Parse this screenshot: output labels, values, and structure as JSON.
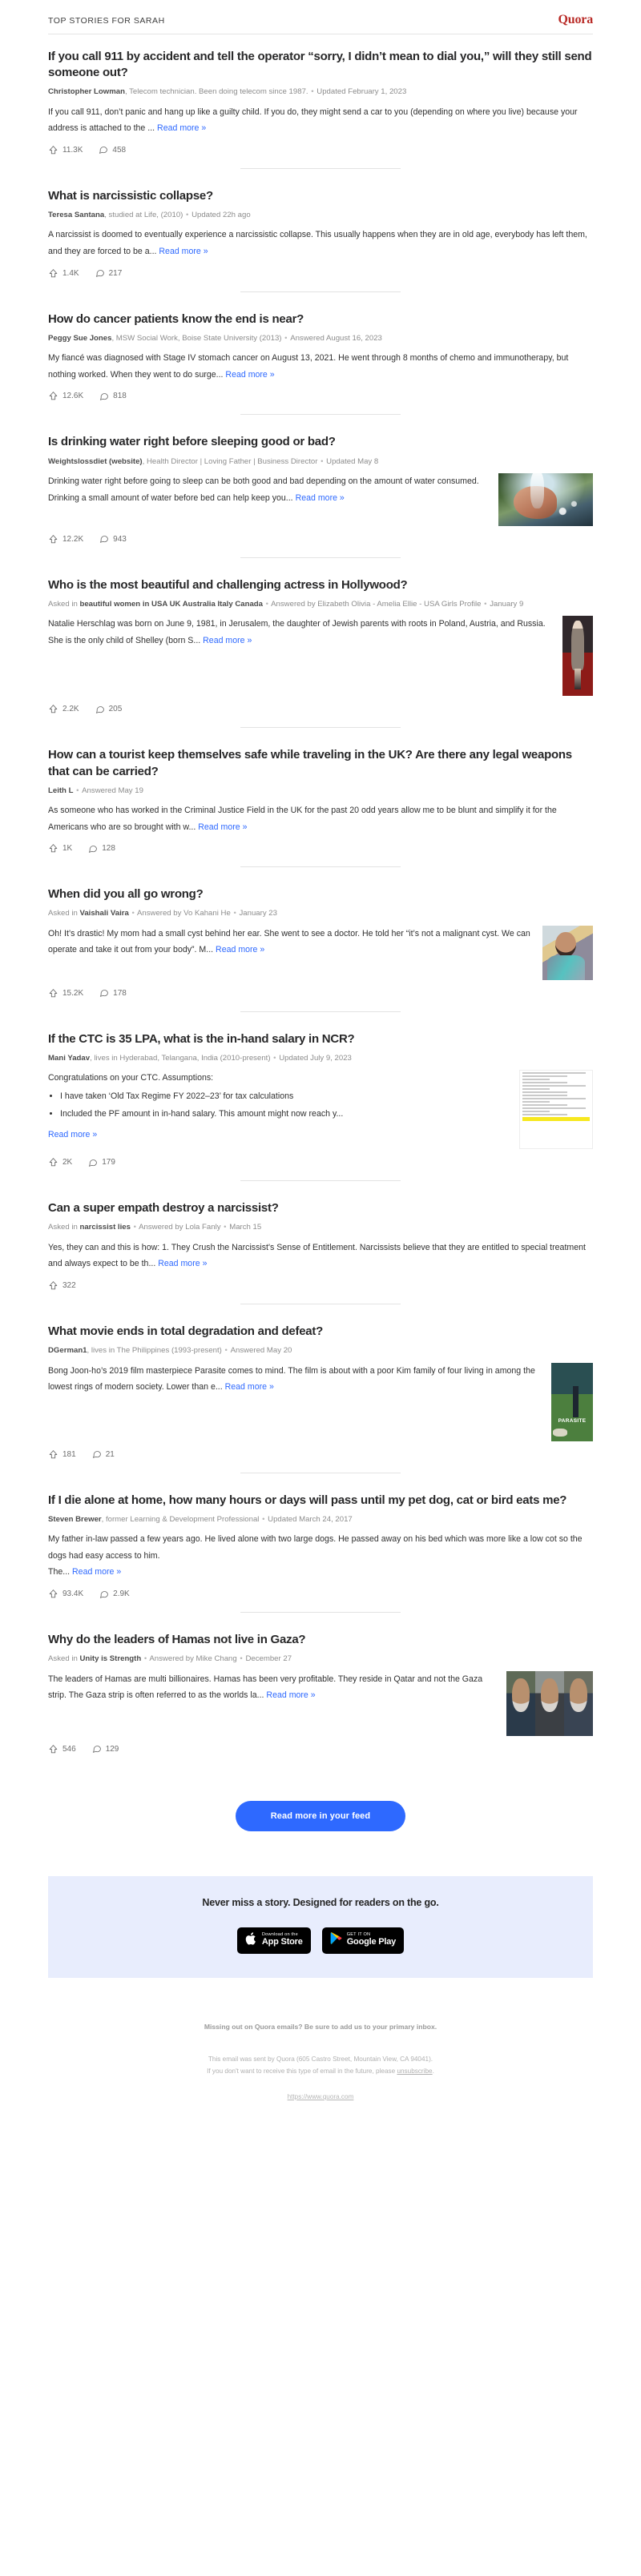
{
  "header": {
    "title": "TOP STORIES FOR SARAH",
    "brand": "Quora"
  },
  "labels": {
    "read_more": "Read more »",
    "asked_in": "Asked in ",
    "answered_by": " Answered by ",
    "dot": "•"
  },
  "stories": [
    {
      "title": "If you call 911 by accident and tell the operator “sorry, I didn’t mean to dial you,” will they still send someone out?",
      "author": "Christopher Lowman",
      "credential": ", Telecom technician. Been doing telecom since 1987.",
      "date": "Updated February 1, 2023",
      "excerpt": "If you call 911, don’t panic and hang up like a guilty child. If you do, they might send a car to you (depending on where you live) because your address is attached to the ...",
      "upvotes": "11.3K",
      "comments": "458",
      "thumb": "none"
    },
    {
      "title": "What is narcissistic collapse?",
      "author": "Teresa Santana",
      "credential": ", studied at Life, (2010)",
      "date": "Updated 22h ago",
      "excerpt": "A narcissist is doomed to eventually experience a narcissistic collapse. This usually happens when they are in old age, everybody has left them, and they are forced to be a...",
      "upvotes": "1.4K",
      "comments": "217",
      "thumb": "none"
    },
    {
      "title": "How do cancer patients know the end is near?",
      "author": "Peggy Sue Jones",
      "credential": ", MSW Social Work, Boise State University (2013)",
      "date": "Answered August 16, 2023",
      "excerpt": "My fiancé was diagnosed with Stage IV stomach cancer on August 13, 2021. He went through 8 months of chemo and immunotherapy, but nothing worked. When they went to do surge...",
      "upvotes": "12.6K",
      "comments": "818",
      "thumb": "none"
    },
    {
      "title": "Is drinking water right before sleeping good or bad?",
      "author": "Weightslossdiet (website)",
      "credential": ", Health Director | Loving Father | Business Director",
      "date": "Updated May 8",
      "excerpt": "Drinking water right before going to sleep can be both good and bad depending on the amount of water consumed. Drinking a small amount of water before bed can help keep you...",
      "upvotes": "12.2K",
      "comments": "943",
      "thumb": "water-hands-photo"
    },
    {
      "title": "Who is the most beautiful and challenging actress in Hollywood?",
      "topic": "beautiful women in USA UK Australia Italy Canada",
      "answerer": "Elizabeth Olivia - Amelia Ellie - USA Girls Profile",
      "date": "January 9",
      "excerpt": "Natalie Herschlag was born on June 9, 1981, in Jerusalem, the daughter of Jewish parents with roots in Poland, Austria, and Russia. She is the only child of Shelley (born S...",
      "upvotes": "2.2K",
      "comments": "205",
      "thumb": "actress-red-carpet-photo"
    },
    {
      "title": "How can a tourist keep themselves safe while traveling in the UK? Are there any legal weapons that can be carried?",
      "author": "Leith L",
      "credential": "",
      "date": "Answered May 19",
      "excerpt": "As someone who has worked in the Criminal Justice Field in the UK for the past 20 odd years allow me to be blunt and simplify it for the Americans who are so brought with w...",
      "upvotes": "1K",
      "comments": "128",
      "thumb": "none"
    },
    {
      "title": "When did you all go wrong?",
      "topic": "Vaishali Vaira",
      "answerer": "Vo Kahani He",
      "date": "January 23",
      "excerpt": "Oh! It’s drastic! My mom had a small cyst behind her ear. She went to see a doctor. He told her “it’s not a malignant cyst. We can operate and take it out from your body”. M...",
      "upvotes": "15.2K",
      "comments": "178",
      "thumb": "woman-smiling-photo"
    },
    {
      "title": "If the CTC is 35 LPA, what is the in-hand salary in NCR?",
      "author": "Mani Yadav",
      "credential": ", lives in Hyderabad, Telangana, India (2010-present)",
      "date": "Updated July 9, 2023",
      "excerpt": "Congratulations on your CTC. Assumptions:",
      "bullets": [
        "I have taken ‘Old Tax Regime FY 2022–23’ for tax calculations",
        "Included the PF amount in in-hand salary. This amount might now reach y..."
      ],
      "upvotes": "2K",
      "comments": "179",
      "thumb": "salary-spreadsheet-photo"
    },
    {
      "title": "Can a super empath destroy a narcissist?",
      "topic": "narcissist lies",
      "answerer": "Lola Fanly",
      "date": "March 15",
      "excerpt": "Yes, they can and this is how: 1. They Crush the Narcissist's Sense of Entitlement. Narcissists believe that they are entitled to special treatment and always expect to be th...",
      "upvotes": "322",
      "comments": "",
      "thumb": "none"
    },
    {
      "title": "What movie ends in total degradation and defeat?",
      "author": "DGerman1",
      "credential": ", lives in The Philippines (1993-present)",
      "date": "Answered May 20",
      "excerpt": "Bong Joon-ho’s 2019 film masterpiece Parasite comes to mind. The film is about with a poor Kim family of four living in among the lowest rings of modern society. Lower than e...",
      "upvotes": "181",
      "comments": "21",
      "thumb": "parasite-poster-photo",
      "thumb_caption": "PARASITE"
    },
    {
      "title": "If I die alone at home, how many hours or days will pass until my pet dog, cat or bird eats me?",
      "author": "Steven Brewer",
      "credential": ", former Learning & Development Professional",
      "date": "Updated March 24, 2017",
      "excerpt": "My father in-law passed a few years ago. He lived alone with two large dogs. He passed away on his bed which was more like a low cot so the dogs had easy access to him.",
      "excerpt2": "The...",
      "upvotes": "93.4K",
      "comments": "2.9K",
      "thumb": "none"
    },
    {
      "title": "Why do the leaders of Hamas not live in Gaza?",
      "topic": "Unity is Strength",
      "answerer": "Mike Chang",
      "date": "December 27",
      "excerpt": "The leaders of Hamas are multi billionaires. Hamas has been very profitable. They reside in Qatar and not the Gaza strip. The Gaza strip is often referred to as the worlds la...",
      "upvotes": "546",
      "comments": "129",
      "thumb": "hamas-leaders-photo"
    }
  ],
  "cta": {
    "label": "Read more in your feed"
  },
  "promo": {
    "title": "Never miss a story. Designed for readers on the go.",
    "app_store": {
      "small": "Download on the",
      "big": "App Store"
    },
    "google_play": {
      "small": "GET IT ON",
      "big": "Google Play"
    }
  },
  "footer": {
    "notice": "Missing out on Quora emails? Be sure to add us to your primary inbox.",
    "sent_by": "This email was sent by Quora (605 Castro Street, Mountain View, CA 94041).",
    "optout_prefix": "If you don't want to receive this type of email in the future, please ",
    "unsubscribe": "unsubscribe",
    "optout_suffix": ".",
    "url": "https://www.quora.com"
  },
  "colors": {
    "brand_red": "#b92b27",
    "link_blue": "#2e69ff",
    "promo_bg": "#e8edfd"
  }
}
